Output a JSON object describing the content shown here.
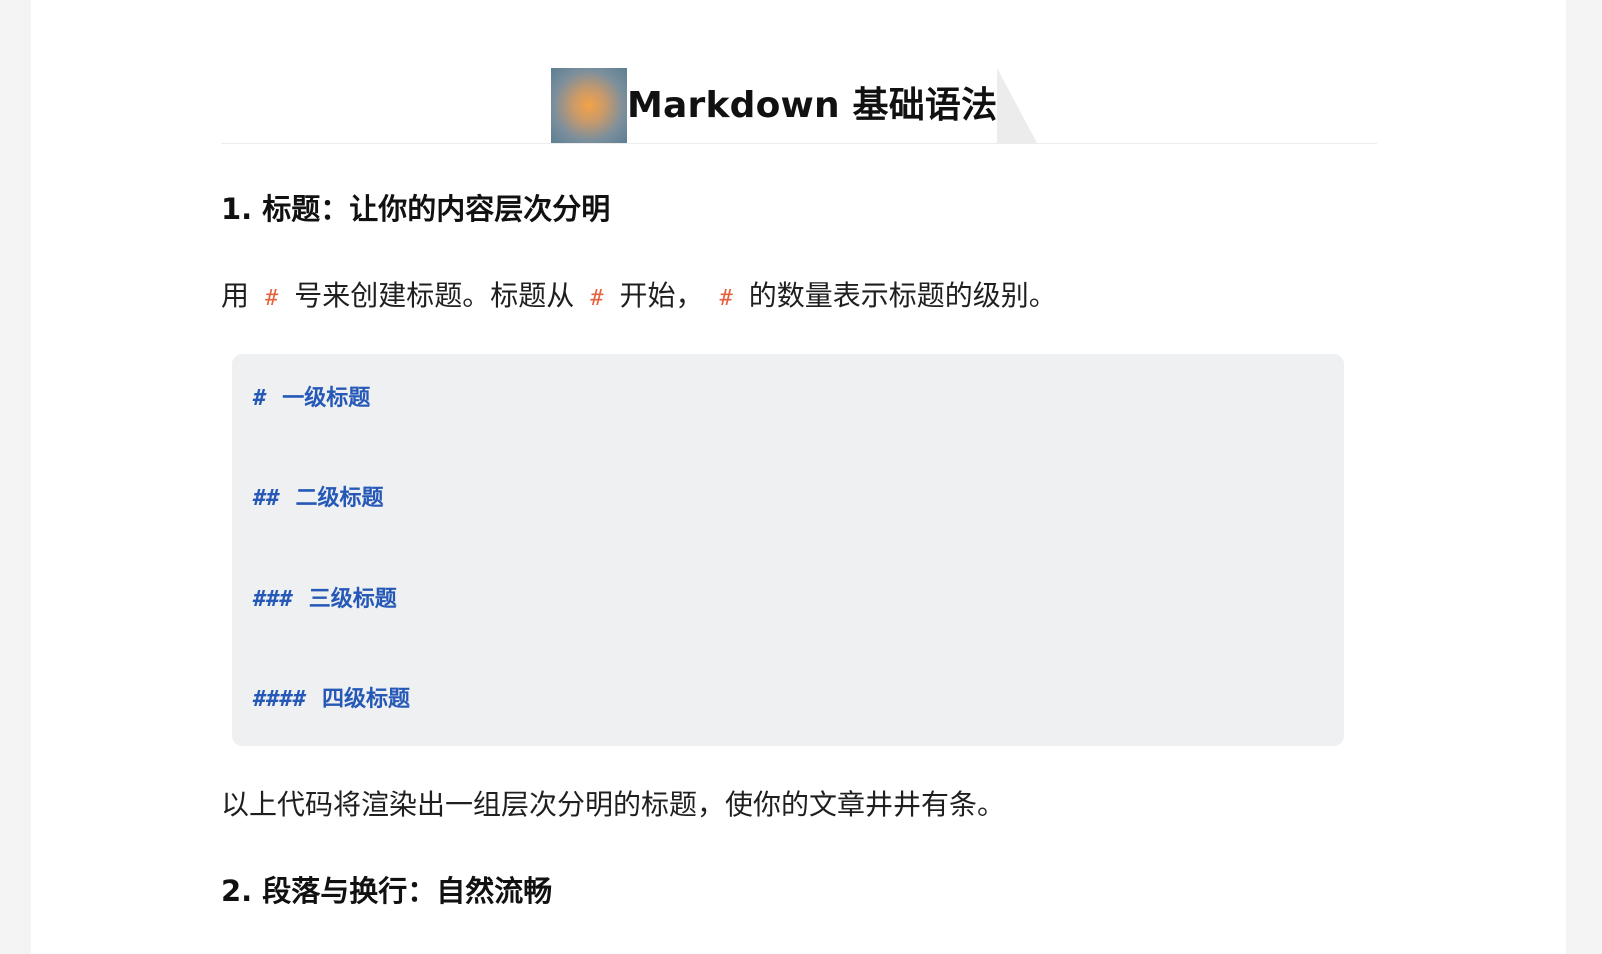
{
  "document": {
    "title": "Markdown 基础语法",
    "section1": {
      "heading": "1. 标题：让你的内容层次分明",
      "intro": {
        "text1": "用",
        "code1": "#",
        "text2": "号来创建标题。标题从",
        "code2": "#",
        "text3": "开始，",
        "code3": "#",
        "text4": "的数量表示标题的级别。"
      },
      "code_lines": [
        {
          "marks": "#",
          "text": "一级标题"
        },
        {
          "marks": "##",
          "text": "二级标题"
        },
        {
          "marks": "###",
          "text": "三级标题"
        },
        {
          "marks": "####",
          "text": "四级标题"
        }
      ],
      "outro": "以上代码将渲染出一组层次分明的标题，使你的文章井井有条。"
    },
    "section2": {
      "heading": "2. 段落与换行：自然流畅"
    }
  },
  "colors": {
    "inline_code": "#e5613d",
    "code_text": "#2659b7",
    "code_bg": "#eff0f2"
  }
}
